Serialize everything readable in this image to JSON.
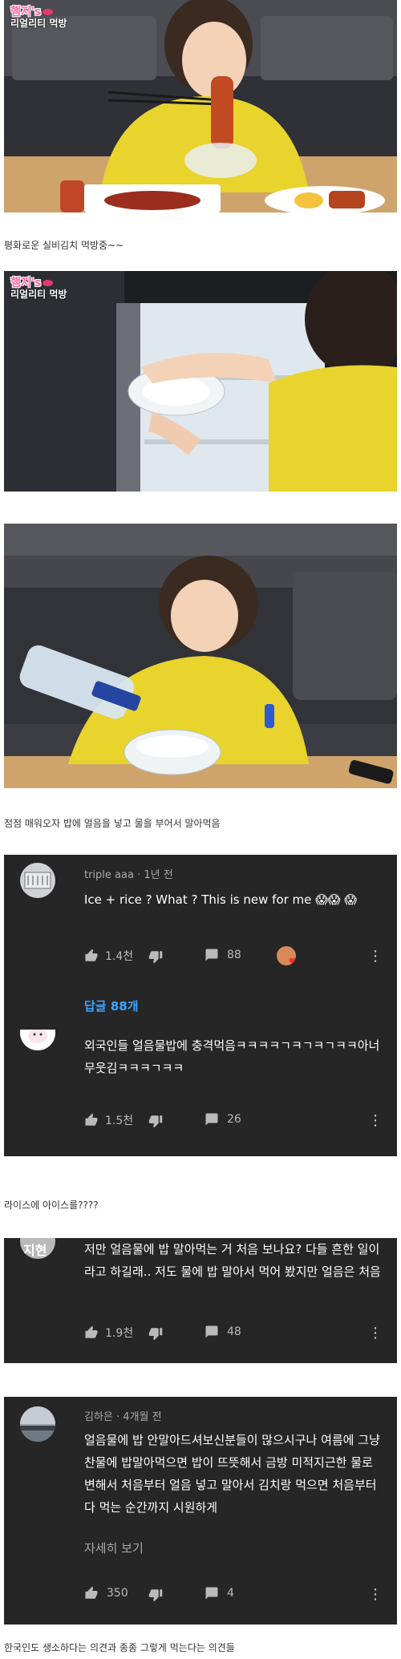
{
  "shows": {
    "logo_line1": "햄지's",
    "logo_line2": "리얼리티 먹방"
  },
  "captions": {
    "c1": "평화로운 실비김치 먹방중~~",
    "c2": "점점 매워오자 밥에 얼음을 넣고 물을 부어서 말아먹음",
    "c3": "라이스에 아이스를????",
    "c4": "한국인도 생소하다는 의견과 종종 그렇게 먹는다는 의견들"
  },
  "comments": [
    {
      "author": "triple aaa",
      "time": "1년 전",
      "text": "Ice + rice ? What ? This is new for me 😱😱 😱",
      "likes": "1.4천",
      "replies_count": "88",
      "reply_link": "답글 88개"
    },
    {
      "text": "외국인들 얼음물밥에 충격먹음ㅋㅋㅋㅋㄱㅋㄱㅋㄱㅋㅋ아너무웃김ㅋㅋㅋㄱㅋㅋ",
      "likes": "1.5천",
      "replies_count": "26"
    },
    {
      "avatar_text": "지현",
      "text": "저만 얼음물에 밥 말아먹는 거 처음 보나요? 다들 흔한 일이라고 하길래.. 저도 물에 밥 말아서 먹어 봤지만 얼음은 처음",
      "likes": "1.9천",
      "replies_count": "48"
    },
    {
      "author": "김하은",
      "time": "4개월 전",
      "text": "얼음물에 밥 안말아드셔보신분들이 많으시구나 여름에 그냥 찬물에 밥말아먹으면 밥이 뜨뜻해서 금방 미적지근한 물로 변해서 처음부터 얼음 넣고 말아서 김치랑 먹으면 처음부터 다 먹는 순간까지 시원하게",
      "read_more": "자세히 보기",
      "likes": "350",
      "replies_count": "4"
    }
  ],
  "icons": {
    "like": "thumbs-up-icon",
    "dislike": "thumbs-down-icon",
    "reply": "comment-icon",
    "menu": "more-vert-icon"
  },
  "colors": {
    "card_bg": "#262626",
    "link": "#3ea6ff",
    "shirt": "#e8d42c"
  }
}
